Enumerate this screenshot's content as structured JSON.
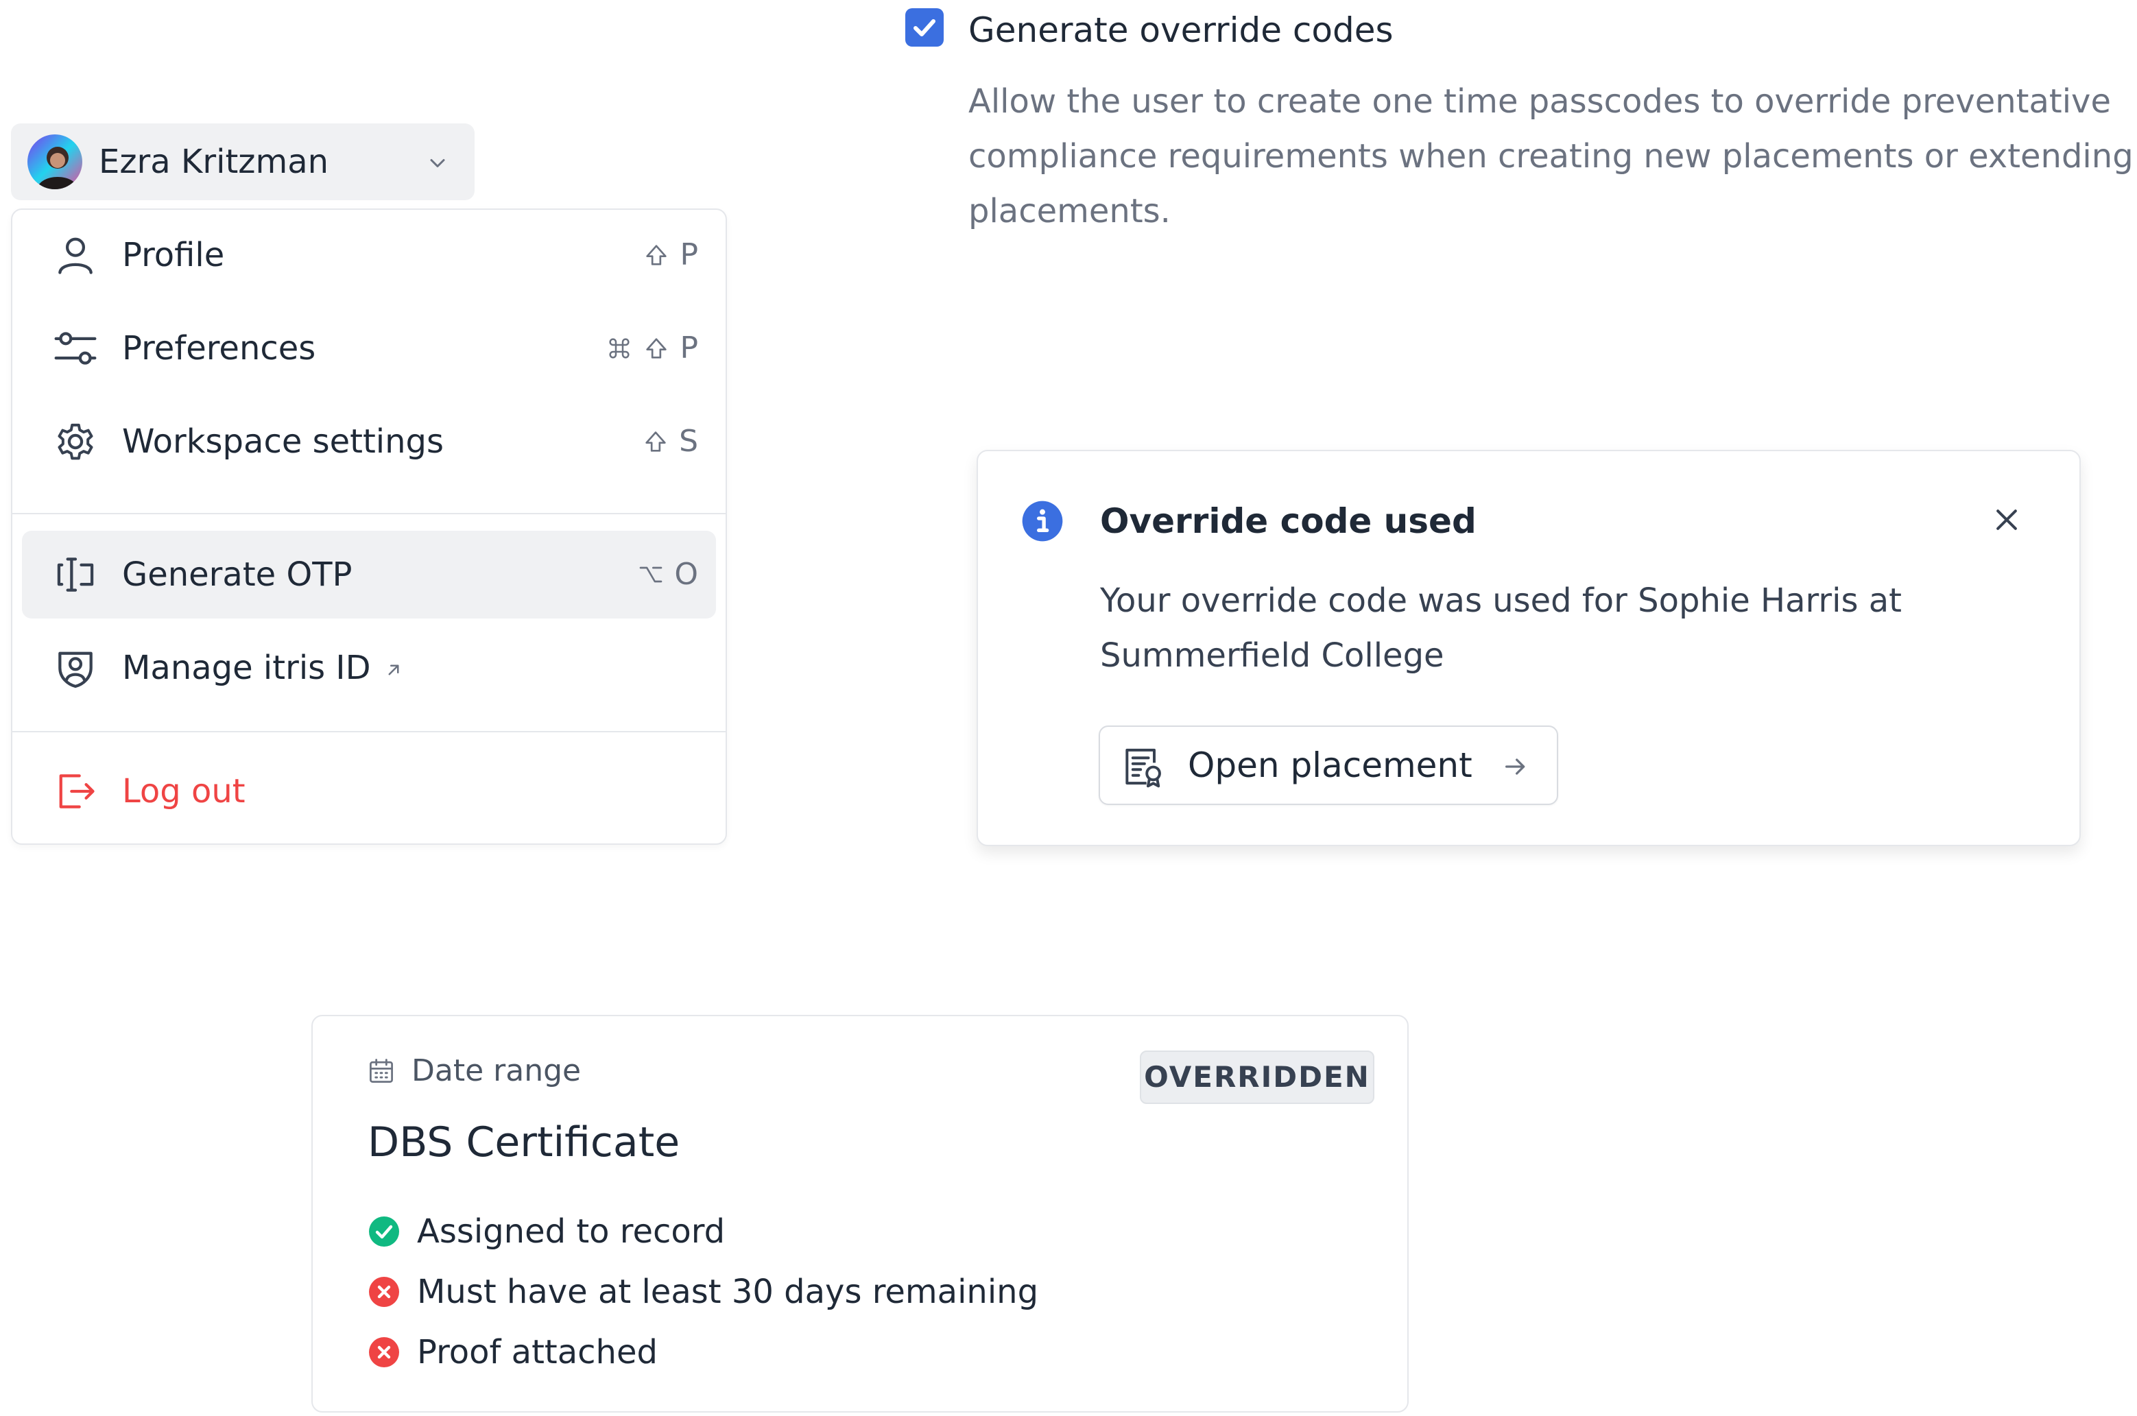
{
  "setting": {
    "checked": true,
    "title": "Generate override codes",
    "description": "Allow the user to create one time passcodes to override preventative compliance requirements when creating new placements or extending placements."
  },
  "user": {
    "name": "Ezra Kritzman"
  },
  "menu": {
    "items": [
      {
        "label": "Profile",
        "icon": "user-icon",
        "shortcut": [
          "shift",
          "P"
        ]
      },
      {
        "label": "Preferences",
        "icon": "sliders-icon",
        "shortcut": [
          "cmd",
          "shift",
          "P"
        ]
      },
      {
        "label": "Workspace settings",
        "icon": "gear-icon",
        "shortcut": [
          "shift",
          "S"
        ]
      },
      {
        "label": "Generate OTP",
        "icon": "text-cursor-input-icon",
        "shortcut": [
          "option",
          "O"
        ],
        "active": true
      },
      {
        "label": "Manage itris ID",
        "icon": "user-shield-icon",
        "external": true
      }
    ],
    "logout_label": "Log out"
  },
  "toast": {
    "title": "Override code used",
    "message": "Your override code was used for Sophie Harris at Summerfield College",
    "button_label": "Open placement"
  },
  "card": {
    "date_label": "Date range",
    "badge": "OVERRIDDEN",
    "title": "DBS Certificate",
    "requirements": [
      {
        "label": "Assigned to record",
        "status": "pass"
      },
      {
        "label": "Must have at least 30 days remaining",
        "status": "fail"
      },
      {
        "label": "Proof attached",
        "status": "fail"
      }
    ]
  },
  "colors": {
    "accent": "#3b6fe0",
    "danger": "#ef4444",
    "success": "#10b981",
    "text": "#1f2937",
    "muted": "#6b7280"
  }
}
